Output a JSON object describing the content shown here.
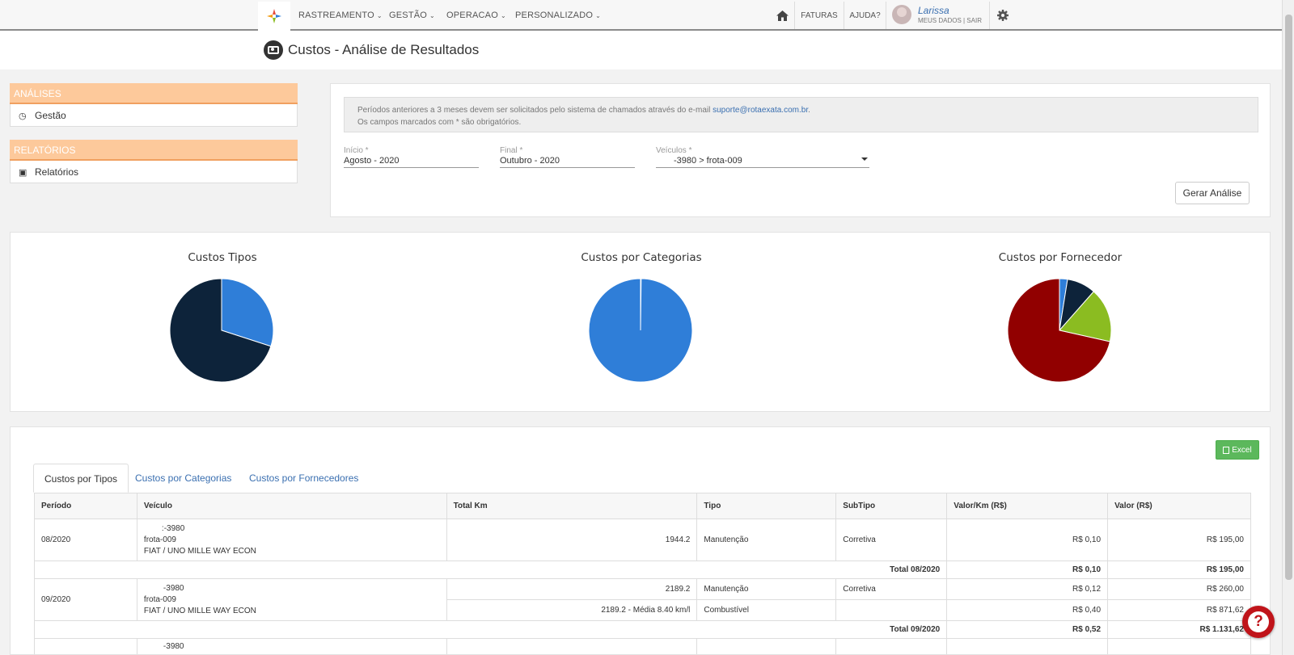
{
  "nav": {
    "items": [
      "RASTREAMENTO",
      "GESTÃO",
      "OPERACAO",
      "PERSONALIZADO"
    ],
    "faturas": "FATURAS",
    "ajuda": "AJUDA?",
    "user_name": "Larissa",
    "user_links": "MEUS DADOS | SAIR"
  },
  "page": {
    "title": "Custos - Análise de Resultados"
  },
  "sidebar": {
    "analises_header": "ANÁLISES",
    "analises_item": "Gestão",
    "relatorios_header": "RELATÓRIOS",
    "relatorios_item": "Relatórios"
  },
  "filters": {
    "notice_line1": "Períodos anteriores a 3 meses devem ser solicitados pelo sistema de chamados através do e-mail ",
    "notice_email": "suporte@rotaexata.com.br",
    "notice_line1_end": ".",
    "notice_line2": "Os campos marcados com * são obrigatórios.",
    "inicio_label": "Início *",
    "inicio_value": "Agosto - 2020",
    "final_label": "Final *",
    "final_value": "Outubro - 2020",
    "veiculos_label": "Veículos *",
    "veiculos_value": "-3980 > frota-009",
    "gerar_label": "Gerar Análise"
  },
  "chart_data": [
    {
      "type": "pie",
      "title": "Custos Tipos",
      "values": [
        0.3,
        0.7
      ],
      "colors": [
        "#2f7ed8",
        "#0d233a"
      ]
    },
    {
      "type": "pie",
      "title": "Custos por Categorias",
      "values": [
        0.002,
        0.998
      ],
      "colors": [
        "#ffffff",
        "#2f7ed8"
      ]
    },
    {
      "type": "pie",
      "title": "Custos por Fornecedor",
      "values": [
        0.025,
        0.09,
        0.17,
        0.715
      ],
      "colors": [
        "#2f7ed8",
        "#0d233a",
        "#8bbc21",
        "#910000"
      ]
    }
  ],
  "table": {
    "excel_label": "Excel",
    "tabs": [
      "Custos por Tipos",
      "Custos por Categorias",
      "Custos por Fornecedores"
    ],
    "headers": {
      "periodo": "Período",
      "veiculo": "Veículo",
      "total_km": "Total Km",
      "tipo": "Tipo",
      "subtipo": "SubTipo",
      "valor_km": "Valor/Km (R$)",
      "valor": "Valor (R$)"
    },
    "groups": [
      {
        "periodo": "08/2020",
        "veiculo_l1": ":-3980",
        "veiculo_l2": "frota-009",
        "veiculo_l3": "FIAT / UNO MILLE WAY ECON",
        "rows": [
          {
            "total_km": "1944.2",
            "tipo": "Manutenção",
            "subtipo": "Corretiva",
            "valor_km": "R$ 0,10",
            "valor": "R$ 195,00"
          }
        ],
        "total_label": "Total 08/2020",
        "total_valor_km": "R$ 0,10",
        "total_valor": "R$ 195,00"
      },
      {
        "periodo": "09/2020",
        "veiculo_l1": "-3980",
        "veiculo_l2": "frota-009",
        "veiculo_l3": "FIAT / UNO MILLE WAY ECON",
        "rows": [
          {
            "total_km": "2189.2",
            "tipo": "Manutenção",
            "subtipo": "Corretiva",
            "valor_km": "R$ 0,12",
            "valor": "R$ 260,00"
          },
          {
            "total_km": "2189.2 - Média 8.40 km/l",
            "tipo": "Combustível",
            "subtipo": "",
            "valor_km": "R$ 0,40",
            "valor": "R$ 871,62"
          }
        ],
        "total_label": "Total 09/2020",
        "total_valor_km": "R$ 0,52",
        "total_valor": "R$ 1.131,62"
      }
    ],
    "next_veiculo_l1": "-3980"
  }
}
